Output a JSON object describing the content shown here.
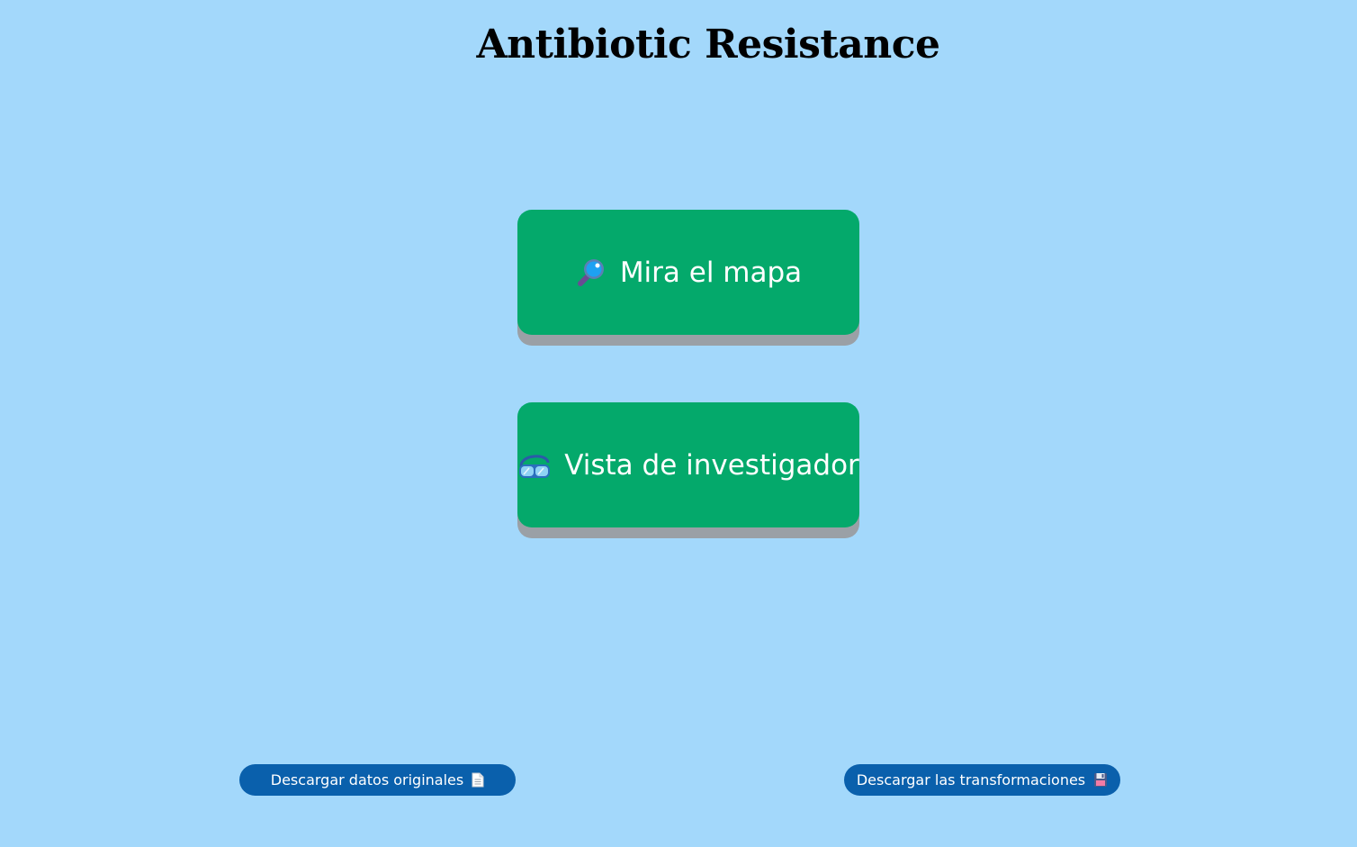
{
  "header": {
    "title": "Antibiotic Resistance"
  },
  "main": {
    "map_button": {
      "label": "Mira el mapa",
      "icon": "magnifying-glass-icon"
    },
    "researcher_button": {
      "label": "Vista de investigador",
      "icon": "goggles-icon"
    }
  },
  "footer": {
    "download_original": {
      "label": "Descargar datos originales",
      "icon": "document-icon"
    },
    "download_transformations": {
      "label": "Descargar las transformaciones",
      "icon": "floppy-disk-icon"
    }
  },
  "colors": {
    "background": "#a3d8fb",
    "primary_button": "#04a96b",
    "button_shadow": "#9aa0a6",
    "download_button": "#0a60ac",
    "text_light": "#ffffff",
    "title_text": "#000000"
  }
}
